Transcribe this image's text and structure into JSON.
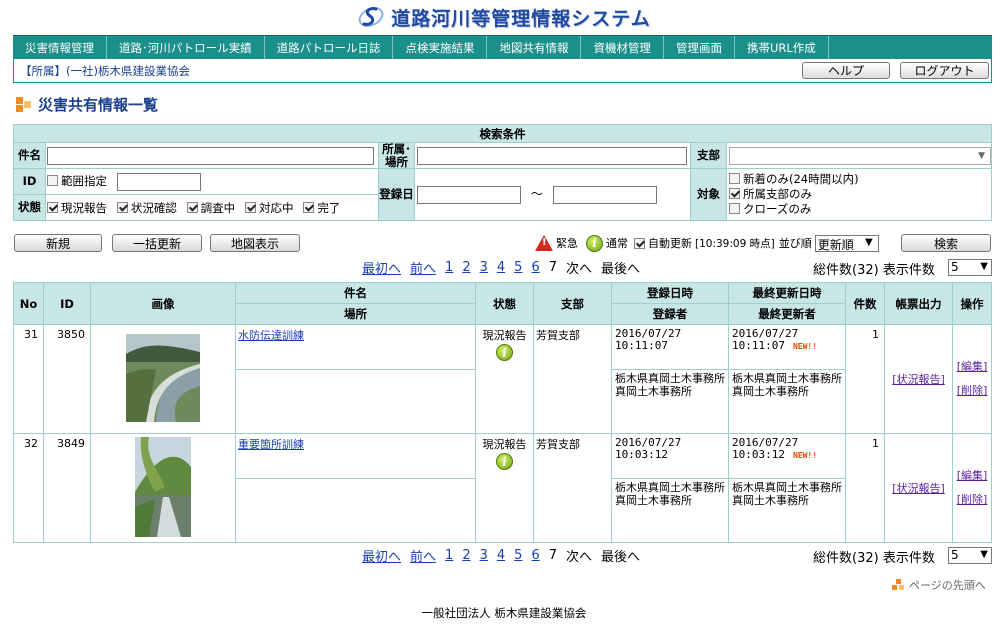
{
  "app": {
    "title": "道路河川等管理情報システム",
    "logo_icon": "s-logo-icon"
  },
  "nav": [
    "災害情報管理",
    "道路･河川パトロール実績",
    "道路パトロール日誌",
    "点検実施結果",
    "地図共有情報",
    "資機材管理",
    "管理画面",
    "携帯URL作成"
  ],
  "affiliation": "【所属】(一社)栃木県建設業協会",
  "header_buttons": {
    "help": "ヘルプ",
    "logout": "ログアウト"
  },
  "page_title": "災害共有情報一覧",
  "search": {
    "header": "検索条件",
    "name_label": "件名",
    "office_label": "所属･場所",
    "branch_label": "支部",
    "id_label": "ID",
    "range_label": "範囲指定",
    "reg_label": "登録日",
    "range_sep": "～",
    "target_label": "対象",
    "targets": [
      {
        "label": "新着のみ(24時間以内)",
        "checked": false
      },
      {
        "label": "所属支部のみ",
        "checked": true
      },
      {
        "label": "クローズのみ",
        "checked": false
      }
    ],
    "status_label": "状態",
    "statuses": [
      {
        "label": "現況報告",
        "checked": true
      },
      {
        "label": "状況確認",
        "checked": true
      },
      {
        "label": "調査中",
        "checked": true
      },
      {
        "label": "対応中",
        "checked": true
      },
      {
        "label": "完了",
        "checked": true
      }
    ]
  },
  "toolbar": {
    "new": "新規",
    "bulk_update": "一括更新",
    "map_view": "地図表示",
    "urgent": "緊急",
    "normal": "通常",
    "auto_update": "自動更新",
    "auto_time": "[10:39:09 時点]",
    "sort_label": "並び順",
    "sort_value": "更新順",
    "search_btn": "検索"
  },
  "pager": {
    "first": "最初へ",
    "prev": "前へ",
    "pages": [
      "1",
      "2",
      "3",
      "4",
      "5",
      "6"
    ],
    "current": "7",
    "next": "次へ",
    "last": "最後へ",
    "total": "総件数(32)",
    "per_page_label": "表示件数",
    "per_page": "5"
  },
  "columns": {
    "no": "No",
    "id": "ID",
    "image": "画像",
    "name": "件名",
    "place": "場所",
    "status": "状態",
    "branch": "支部",
    "reg_date": "登録日時",
    "registrant": "登録者",
    "upd_date": "最終更新日時",
    "updater": "最終更新者",
    "count": "件数",
    "report": "帳票出力",
    "ops": "操作"
  },
  "rows": [
    {
      "no": "31",
      "id": "3850",
      "name": "水防伝達訓練",
      "place": "",
      "status": "現況報告",
      "branch": "芳賀支部",
      "reg_date": "2016/07/27",
      "reg_time": "10:11:07",
      "upd_date": "2016/07/27",
      "upd_time": "10:11:07",
      "new": "NEW!!",
      "registrant": "栃木県真岡土木事務所\n真岡土木事務所",
      "updater": "栃木県真岡土木事務所\n真岡土木事務所",
      "count": "1",
      "report": "[状況報告]",
      "edit": "[編集]",
      "del": "[削除]"
    },
    {
      "no": "32",
      "id": "3849",
      "name": "重要箇所訓練",
      "place": "",
      "status": "現況報告",
      "branch": "芳賀支部",
      "reg_date": "2016/07/27",
      "reg_time": "10:03:12",
      "upd_date": "2016/07/27",
      "upd_time": "10:03:12",
      "new": "NEW!!",
      "registrant": "栃木県真岡土木事務所\n真岡土木事務所",
      "updater": "栃木県真岡土木事務所\n真岡土木事務所",
      "count": "1",
      "report": "[状況報告]",
      "edit": "[編集]",
      "del": "[削除]"
    }
  ],
  "page_top": "ページの先頭へ",
  "footer": "一般社団法人 栃木県建設業協会",
  "colors": {
    "nav": "#1b8f8a",
    "header_cell": "#c8e6e5",
    "border": "#9fcfcd",
    "title": "#1b3f8c",
    "link": "#1a3fb0"
  }
}
